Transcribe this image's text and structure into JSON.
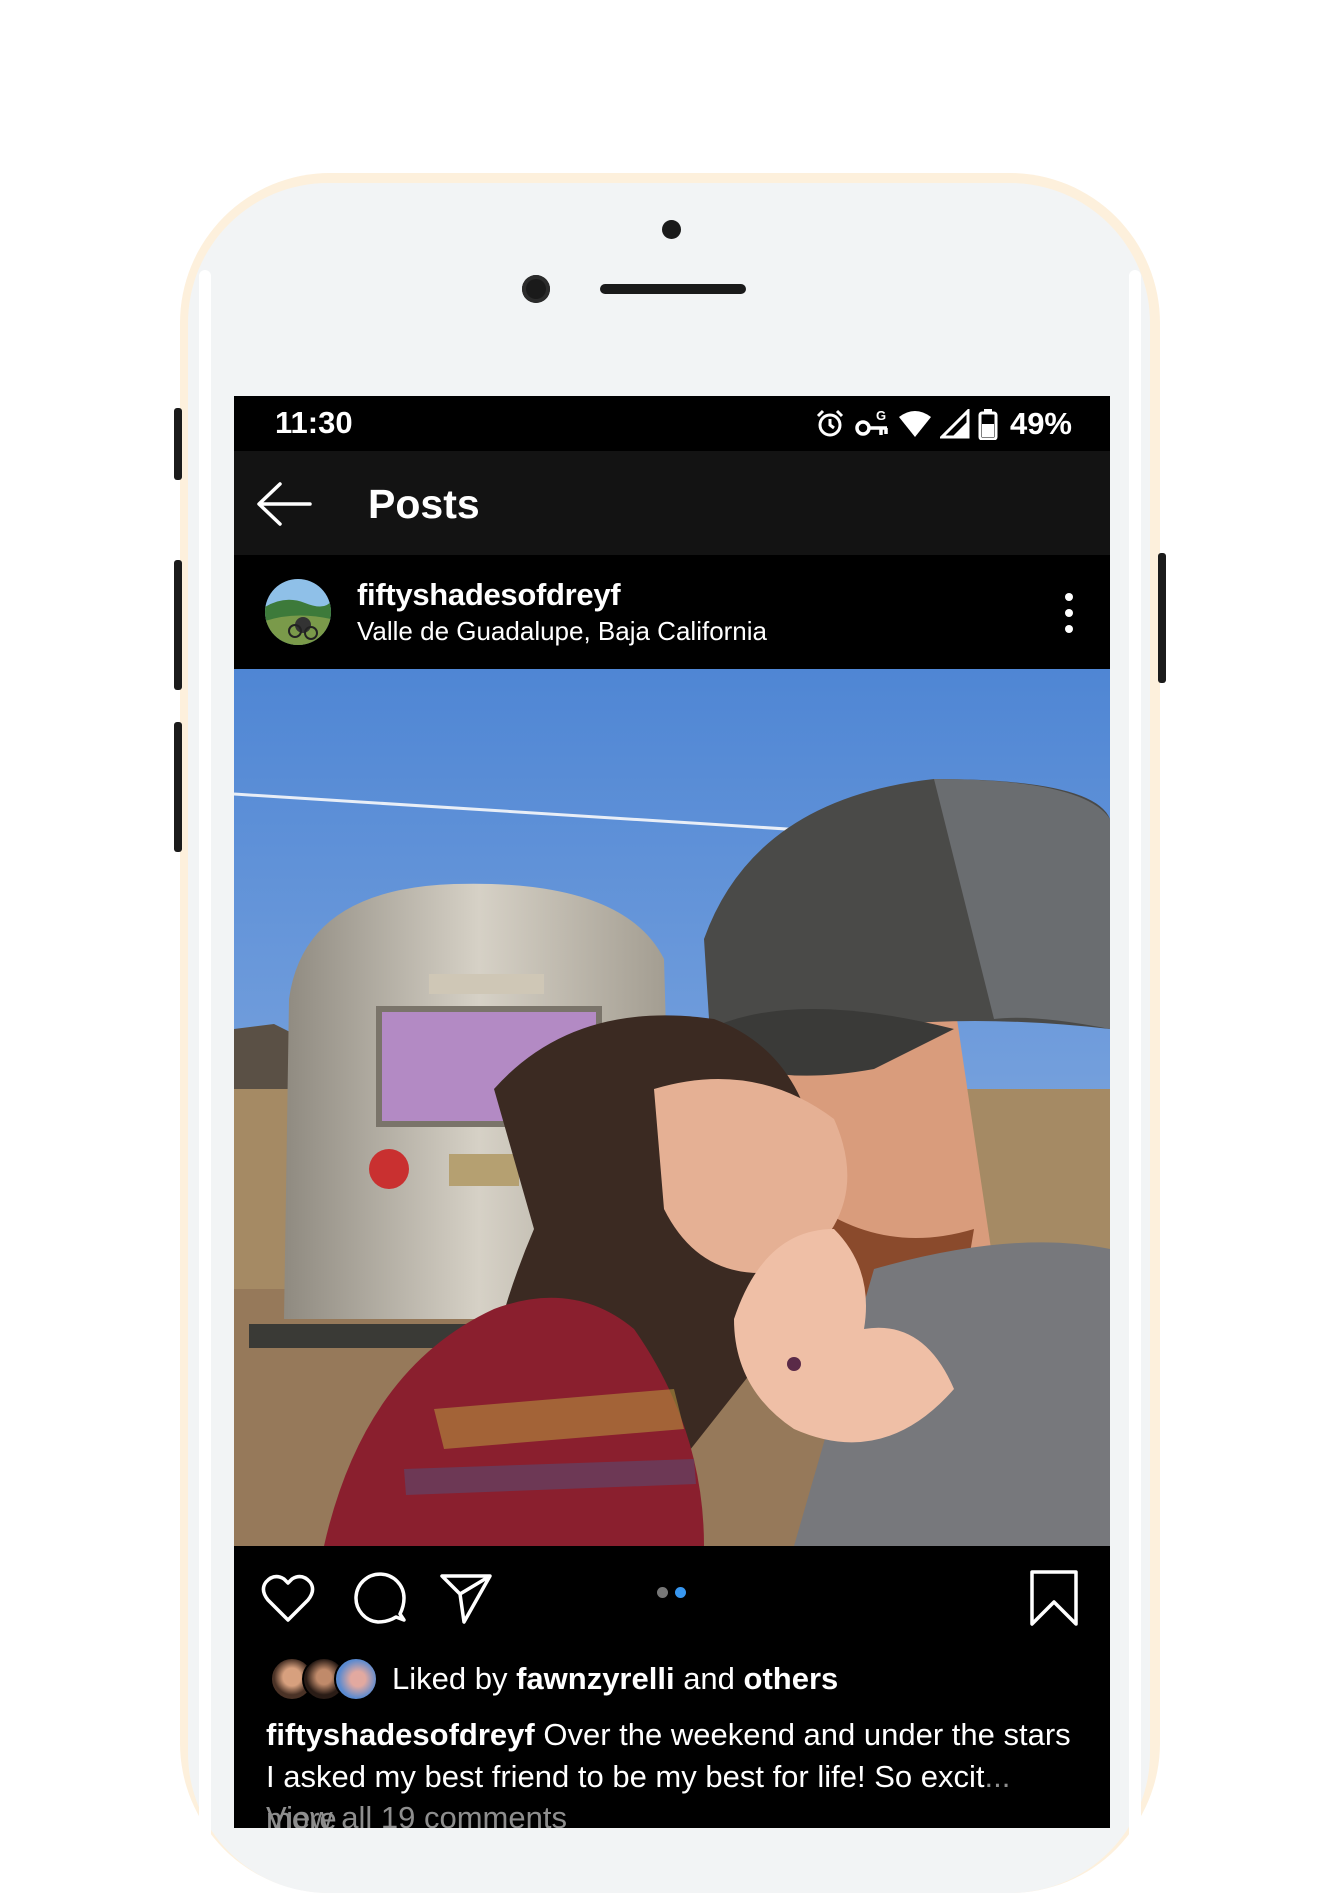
{
  "status_bar": {
    "time": "11:30",
    "battery": "49%",
    "icons": [
      "alarm-icon",
      "vpn-key-icon",
      "wifi-icon",
      "signal-icon",
      "battery-icon"
    ]
  },
  "app_bar": {
    "title": "Posts",
    "back_icon": "arrow-left-icon"
  },
  "post": {
    "username": "fiftyshadesofdreyf",
    "location": "Valle de Guadalupe, Baja California",
    "image_description": "photo-couple-kissing-airstream",
    "carousel": {
      "count": 2,
      "active_index": 1
    },
    "likes": {
      "prefix": "Liked by ",
      "user": "fawnzyrelli",
      "middle": " and ",
      "suffix": "others"
    },
    "caption": {
      "user": "fiftyshadesofdreyf",
      "text": " Over the weekend and under the stars I asked my best friend to be my best for life! So excit",
      "ellipsis": "...",
      "more": " more"
    },
    "view_comments": "View all 19 comments"
  },
  "colors": {
    "accent_blue": "#3897f0",
    "frame": "#fdf0dc",
    "muted_text": "#8e8e8e",
    "app_bar": "#131313"
  }
}
